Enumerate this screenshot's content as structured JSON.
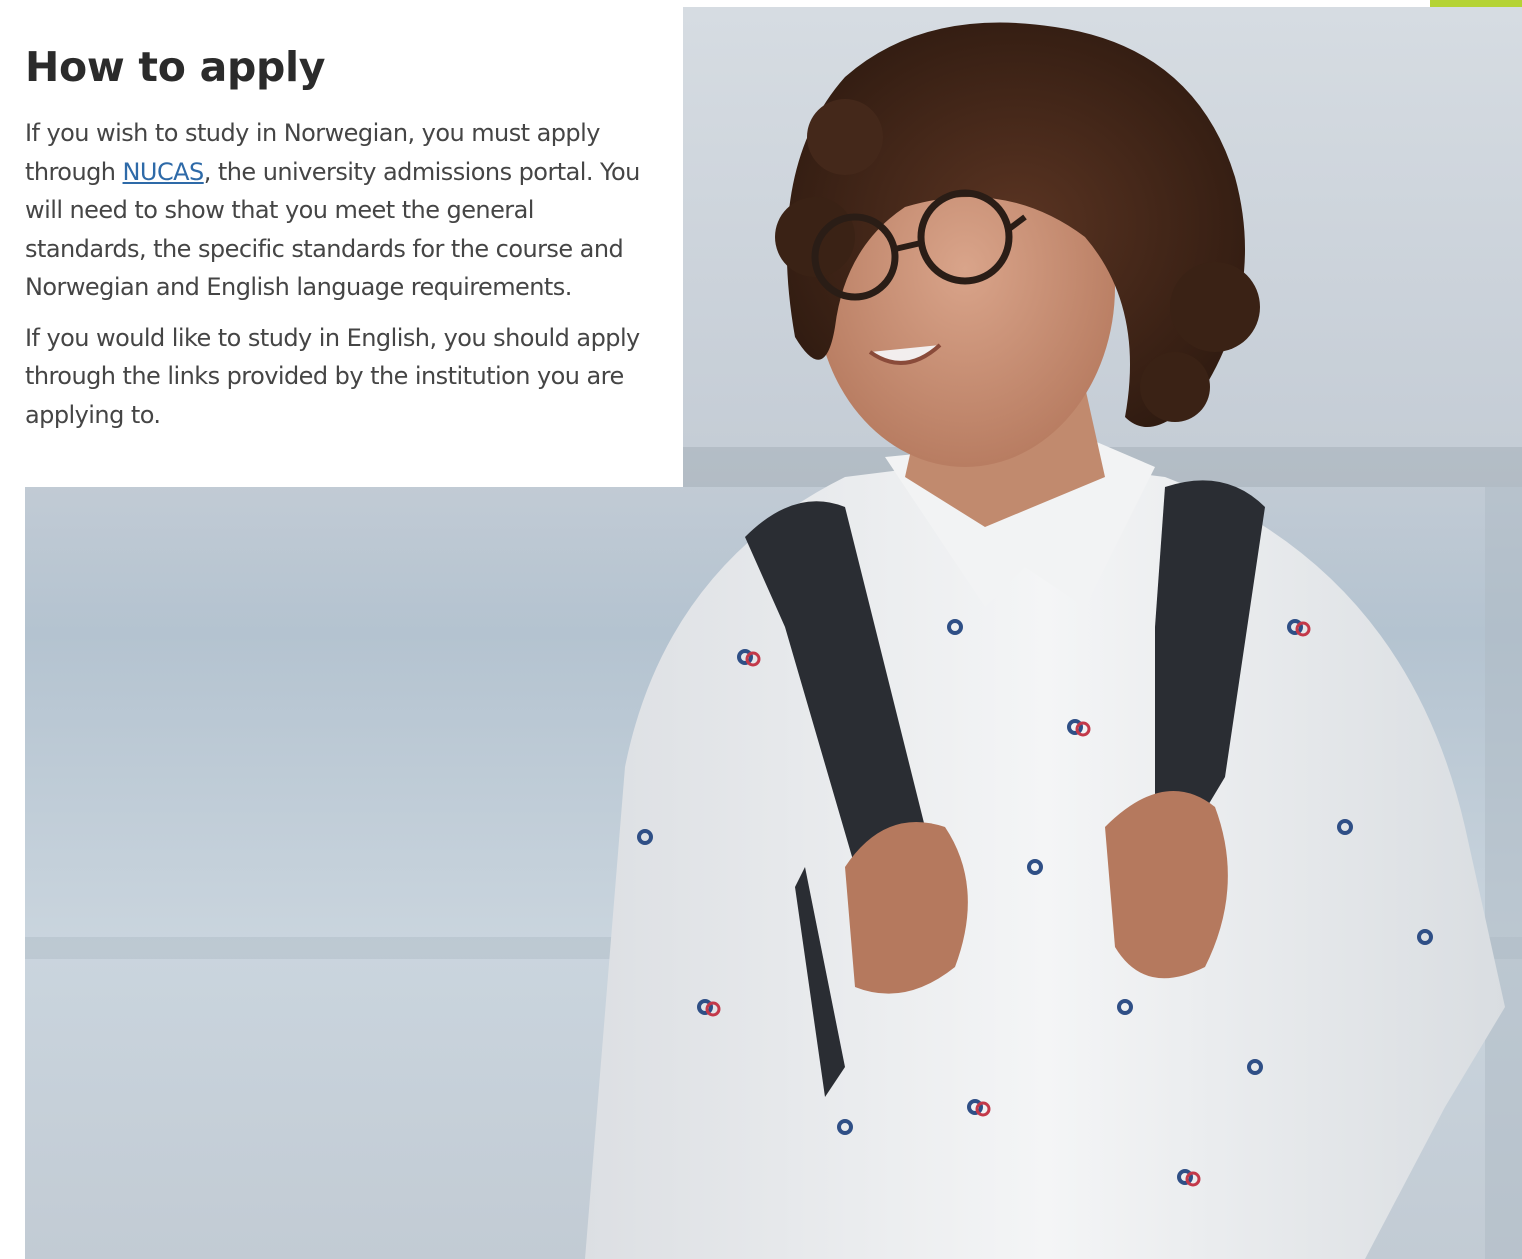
{
  "section": {
    "heading": "How to apply",
    "para1": {
      "before_link": "If you wish to study in Norwegian, you must apply through ",
      "link_text": "NUCAS",
      "after_link": ", the university admissions portal. You will need to show that you meet the general standards, the specific standards for the course and Norwegian and English language requirements."
    },
    "para2": "If you would like to study in English, you should apply through the links provided by the institution you are applying to."
  },
  "colors": {
    "accent": "#b5d334",
    "link": "#2e6aa8",
    "heading": "#2b2b2b",
    "body_text": "#454545"
  }
}
